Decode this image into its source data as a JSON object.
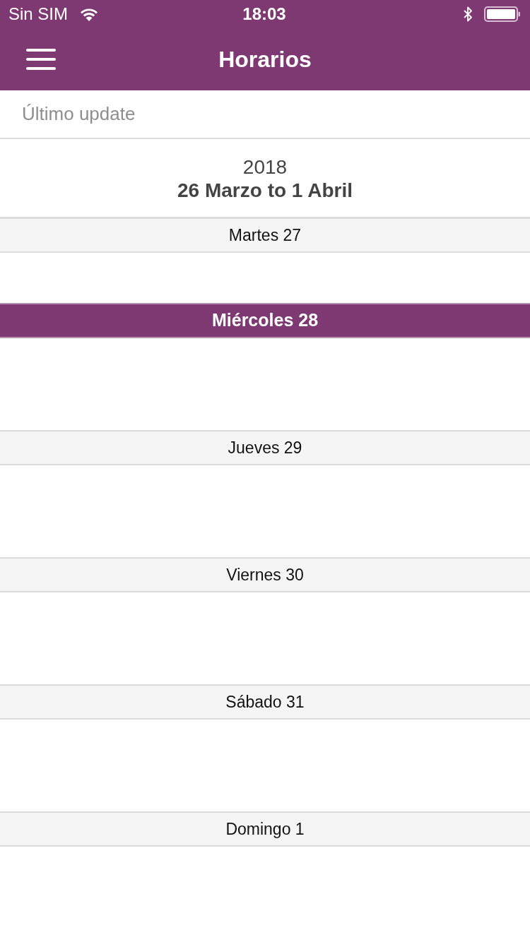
{
  "status_bar": {
    "carrier": "Sin SIM",
    "time": "18:03"
  },
  "nav_bar": {
    "title": "Horarios"
  },
  "last_update": {
    "label": "Último update"
  },
  "week": {
    "year": "2018",
    "range": "26 Marzo to 1 Abril"
  },
  "days": [
    {
      "label": "Martes 27",
      "today": false
    },
    {
      "label": "Miércoles 28",
      "today": true
    },
    {
      "label": "Jueves 29",
      "today": false
    },
    {
      "label": "Viernes 30",
      "today": false
    },
    {
      "label": "Sábado 31",
      "today": false
    },
    {
      "label": "Domingo 1",
      "today": false
    }
  ]
}
